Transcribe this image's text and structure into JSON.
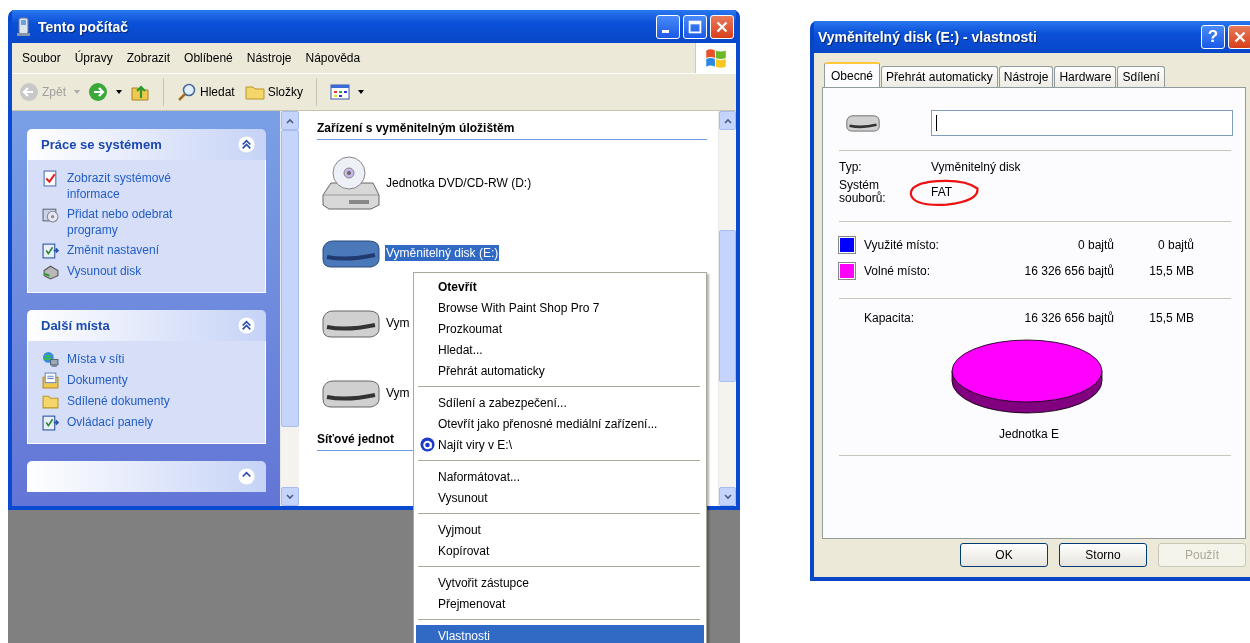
{
  "explorer": {
    "title": "Tento počítač",
    "menu": [
      "Soubor",
      "Úpravy",
      "Zobrazit",
      "Oblíbené",
      "Nástroje",
      "Nápověda"
    ],
    "toolbar": [
      {
        "kind": "back",
        "label": "Zpět",
        "disabled": true
      },
      {
        "kind": "forward",
        "disabled": false
      },
      {
        "kind": "up"
      },
      {
        "kind": "search",
        "label": "Hledat"
      },
      {
        "kind": "folders",
        "label": "Složky"
      },
      {
        "kind": "views"
      }
    ],
    "task_panels": [
      {
        "title": "Práce se systémem",
        "expanded": true,
        "items": [
          {
            "kind": "sysinfo",
            "label": "Zobrazit systémové informace"
          },
          {
            "kind": "addremove",
            "label": "Přidat nebo odebrat programy"
          },
          {
            "kind": "settings",
            "label": "Změnit nastavení"
          },
          {
            "kind": "eject",
            "label": "Vysunout disk"
          }
        ]
      },
      {
        "title": "Další místa",
        "expanded": true,
        "items": [
          {
            "kind": "network",
            "label": "Místa v síti"
          },
          {
            "kind": "documents",
            "label": "Dokumenty"
          },
          {
            "kind": "folder",
            "label": "Sdílené dokumenty"
          },
          {
            "kind": "settings",
            "label": "Ovládací panely"
          }
        ]
      }
    ],
    "sections": [
      {
        "title": "Zařízení s vyměnitelným úložištěm",
        "items": [
          {
            "kind": "optical",
            "label": "Jednotka DVD/CD-RW (D:)",
            "selected": false
          },
          {
            "kind": "removable",
            "label": "Vyměnitelný disk (E:)",
            "selected": true
          },
          {
            "kind": "removable",
            "label": "Vym",
            "selected": false
          },
          {
            "kind": "removable",
            "label": "Vym",
            "selected": false
          }
        ]
      },
      {
        "title": "Síťové jednot"
      }
    ]
  },
  "context_menu": {
    "groups": [
      [
        {
          "label": "Otevřít",
          "default": true,
          "selected": false,
          "has_icon": false
        },
        {
          "label": "Browse With Paint Shop Pro 7",
          "default": false,
          "selected": false,
          "has_icon": false
        },
        {
          "label": "Prozkoumat",
          "default": false,
          "selected": false,
          "has_icon": false
        },
        {
          "label": "Hledat...",
          "default": false,
          "selected": false,
          "has_icon": false
        },
        {
          "label": "Přehrát automaticky",
          "default": false,
          "selected": false,
          "has_icon": false
        }
      ],
      [
        {
          "label": "Sdílení a zabezpečení...",
          "default": false,
          "selected": false,
          "has_icon": false
        },
        {
          "label": "Otevřít jako přenosné mediální zařízení...",
          "default": false,
          "selected": false,
          "has_icon": false
        },
        {
          "label": "Najít viry v E:\\",
          "default": false,
          "selected": false,
          "has_icon": true
        }
      ],
      [
        {
          "label": "Naformátovat...",
          "default": false,
          "selected": false,
          "has_icon": false
        },
        {
          "label": "Vysunout",
          "default": false,
          "selected": false,
          "has_icon": false
        }
      ],
      [
        {
          "label": "Vyjmout",
          "default": false,
          "selected": false,
          "has_icon": false
        },
        {
          "label": "Kopírovat",
          "default": false,
          "selected": false,
          "has_icon": false
        }
      ],
      [
        {
          "label": "Vytvořit zástupce",
          "default": false,
          "selected": false,
          "has_icon": false
        },
        {
          "label": "Přejmenovat",
          "default": false,
          "selected": false,
          "has_icon": false
        }
      ],
      [
        {
          "label": "Vlastnosti",
          "default": false,
          "selected": true,
          "has_icon": false
        }
      ]
    ]
  },
  "dialog": {
    "title": "Vyměnitelný disk (E:) - vlastnosti",
    "help": "?",
    "tabs": [
      {
        "label": "Obecné",
        "selected": true
      },
      {
        "label": "Přehrát automaticky",
        "selected": false
      },
      {
        "label": "Nástroje",
        "selected": false
      },
      {
        "label": "Hardware",
        "selected": false
      },
      {
        "label": "Sdílení",
        "selected": false
      }
    ],
    "info": [
      {
        "label": "Typ:",
        "value": "Vyměnitelný disk",
        "circled": false
      },
      {
        "label": "Systém souborů:",
        "value": "FAT",
        "circled": true
      }
    ],
    "usage": [
      {
        "label": "Využité místo:",
        "bytes": "0 bajtů",
        "size": "0 bajtů",
        "color": "#0000ff"
      },
      {
        "label": "Volné místo:",
        "bytes": "16 326 656 bajtů",
        "size": "15,5 MB",
        "color": "#ff00ff"
      }
    ],
    "capacity": {
      "label": "Kapacita:",
      "bytes": "16 326 656 bajtů",
      "size": "15,5 MB"
    },
    "drive_label": "Jednotka E",
    "buttons": [
      {
        "label": "OK",
        "disabled": false
      },
      {
        "label": "Storno",
        "disabled": false
      },
      {
        "label": "Použít",
        "disabled": true
      }
    ]
  }
}
